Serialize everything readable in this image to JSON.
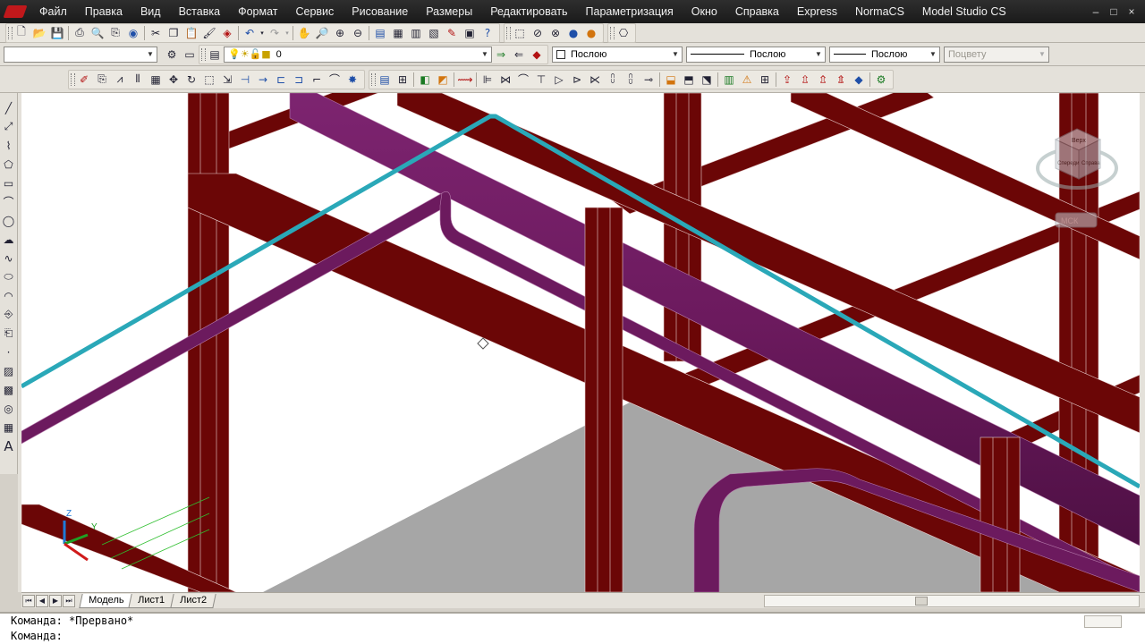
{
  "menubar": {
    "items": [
      "Файл",
      "Правка",
      "Вид",
      "Вставка",
      "Формат",
      "Сервис",
      "Рисование",
      "Размеры",
      "Редактировать",
      "Параметризация",
      "Окно",
      "Справка",
      "Express",
      "NormaCS",
      "Model Studio CS"
    ],
    "window_controls": [
      "–",
      "□",
      "×"
    ]
  },
  "toolbar_standard": {
    "icons": [
      "new-icon",
      "open-icon",
      "save-icon",
      "print-icon",
      "preview-icon",
      "plot-icon",
      "publish-icon",
      "cut-icon",
      "copy-icon",
      "paste-icon",
      "match-properties-icon",
      "block-editor-icon",
      "undo-icon",
      "redo-icon",
      "pan-icon",
      "zoom-realtime-icon",
      "zoom-window-icon",
      "zoom-previous-icon",
      "properties-icon",
      "design-center-icon",
      "tool-palettes-icon",
      "sheet-set-icon",
      "markup-icon",
      "quickcalc-icon",
      "help-icon"
    ],
    "visual_styles": [
      "2d-wireframe-icon",
      "3d-hidden-icon",
      "3d-wireframe-icon",
      "realistic-icon",
      "conceptual-icon"
    ],
    "named_views_icon": "named-views-icon"
  },
  "toolbar_properties": {
    "workspace_value": "",
    "layer_value": "0",
    "color_value": "Послою",
    "linetype_value": "Послою",
    "lineweight_value": "Послою",
    "plotstyle_value": "Поцвету"
  },
  "viewcube": {
    "top_label": "Верх",
    "front_label": "Спереди",
    "right_label": "Справа",
    "ucs_label": "МСК"
  },
  "ucs_icon": {
    "z_label": "Z",
    "y_label": "Y"
  },
  "layout_tabs": {
    "tabs": [
      "Модель",
      "Лист1",
      "Лист2"
    ],
    "active_tab": "Модель"
  },
  "command_line": {
    "history_line": "Команда: *Прервано*",
    "prompt": "Команда:"
  },
  "colors": {
    "steel_beam": "#6b0606",
    "purple_pipe": "#6c1a5e",
    "cyan_pipe": "#2aa8b8",
    "floor_slab": "#a6a6a6",
    "menubar_bg": "#1e1e1e"
  }
}
